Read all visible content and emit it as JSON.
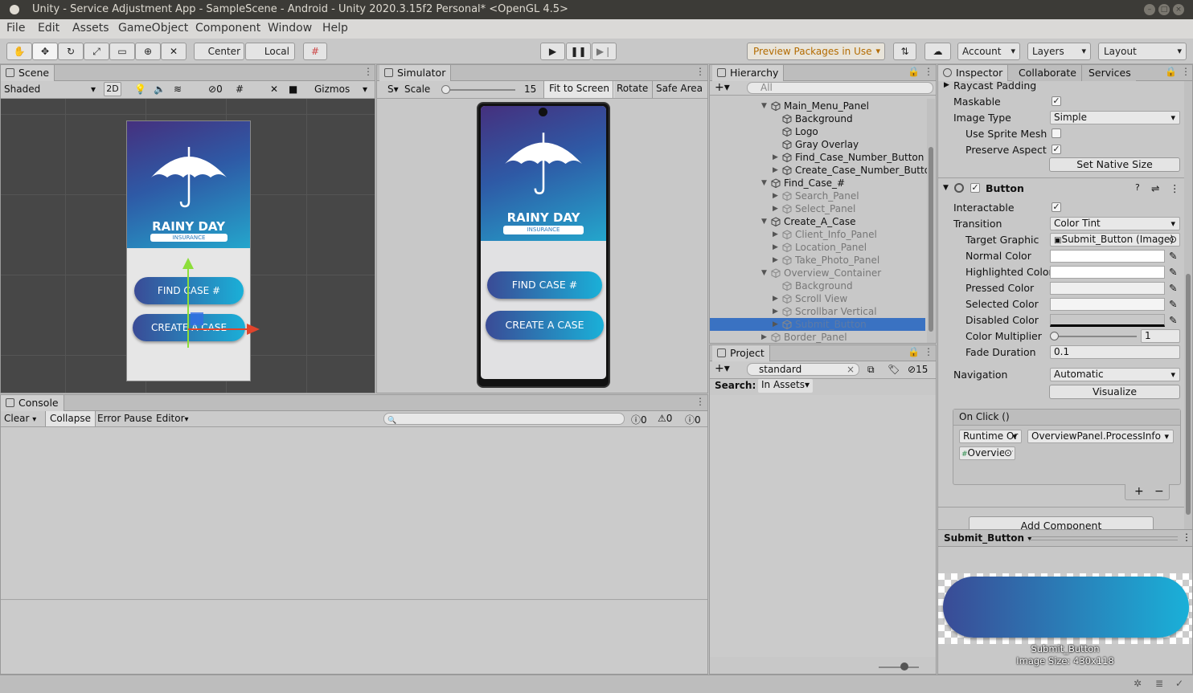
{
  "window": {
    "title": "Unity - Service Adjustment App - SampleScene - Android - Unity 2020.3.15f2 Personal* <OpenGL 4.5>"
  },
  "menu": [
    "File",
    "Edit",
    "Assets",
    "GameObject",
    "Component",
    "Window",
    "Help"
  ],
  "toolbar": {
    "center": "Center",
    "local": "Local",
    "preview_packages": "Preview Packages in Use",
    "account": "Account",
    "layers": "Layers",
    "layout": "Layout"
  },
  "scene": {
    "tab": "Scene",
    "shading": "Shaded",
    "mode_2d": "2D",
    "hidden_count": "0",
    "gizmos": "Gizmos",
    "brand_title": "RAINY DAY",
    "brand_sub": "INSURANCE",
    "btn_find": "FIND CASE #",
    "btn_create": "CREATE A CASE"
  },
  "simulator": {
    "tab": "Simulator",
    "scale_label": "Scale",
    "scale_value": "15",
    "fit": "Fit to Screen",
    "rotate": "Rotate",
    "safe_area": "Safe Area",
    "brand_title": "RAINY DAY",
    "brand_sub": "INSURANCE",
    "btn_find": "FIND CASE #",
    "btn_create": "CREATE A CASE",
    "left_label": "S"
  },
  "hierarchy": {
    "tab": "Hierarchy",
    "search_placeholder": "All",
    "rows": [
      {
        "label": "Main_Menu_Panel",
        "depth": 1,
        "arrow": "open",
        "dim": false
      },
      {
        "label": "Background",
        "depth": 2,
        "arrow": "",
        "dim": false
      },
      {
        "label": "Logo",
        "depth": 2,
        "arrow": "",
        "dim": false
      },
      {
        "label": "Gray Overlay",
        "depth": 2,
        "arrow": "",
        "dim": false
      },
      {
        "label": "Find_Case_Number_Button",
        "depth": 2,
        "arrow": "closed",
        "dim": false
      },
      {
        "label": "Create_Case_Number_Button",
        "depth": 2,
        "arrow": "closed",
        "dim": false
      },
      {
        "label": "Find_Case_#",
        "depth": 1,
        "arrow": "open",
        "dim": false
      },
      {
        "label": "Search_Panel",
        "depth": 2,
        "arrow": "closed",
        "dim": true
      },
      {
        "label": "Select_Panel",
        "depth": 2,
        "arrow": "closed",
        "dim": true
      },
      {
        "label": "Create_A_Case",
        "depth": 1,
        "arrow": "open",
        "dim": false
      },
      {
        "label": "Client_Info_Panel",
        "depth": 2,
        "arrow": "closed",
        "dim": true
      },
      {
        "label": "Location_Panel",
        "depth": 2,
        "arrow": "closed",
        "dim": true
      },
      {
        "label": "Take_Photo_Panel",
        "depth": 2,
        "arrow": "closed",
        "dim": true
      },
      {
        "label": "Overview_Container",
        "depth": 1,
        "arrow": "open",
        "dim": true
      },
      {
        "label": "Background",
        "depth": 2,
        "arrow": "",
        "dim": true
      },
      {
        "label": "Scroll View",
        "depth": 2,
        "arrow": "closed",
        "dim": true
      },
      {
        "label": "Scrollbar Vertical",
        "depth": 2,
        "arrow": "closed",
        "dim": true
      },
      {
        "label": "Submit_Button",
        "depth": 2,
        "arrow": "closed",
        "dim": true,
        "selected": true
      },
      {
        "label": "Border_Panel",
        "depth": 1,
        "arrow": "closed",
        "dim": true
      }
    ]
  },
  "project": {
    "tab": "Project",
    "search_value": "standard",
    "search_label": "Search:",
    "search_scope": "In Assets",
    "hidden_count": "15"
  },
  "console": {
    "tab": "Console",
    "clear": "Clear",
    "collapse": "Collapse",
    "error_pause": "Error Pause",
    "editor": "Editor",
    "log_count": "0",
    "warn_count": "0",
    "error_count": "0"
  },
  "inspector": {
    "tabs": [
      "Inspector",
      "Collaborate",
      "Services"
    ],
    "raycast_padding": "Raycast Padding",
    "maskable": "Maskable",
    "image_type_label": "Image Type",
    "image_type": "Simple",
    "use_sprite_mesh": "Use Sprite Mesh",
    "preserve_aspect": "Preserve Aspect",
    "set_native_size": "Set Native Size",
    "component_title": "Button",
    "interactable": "Interactable",
    "transition_label": "Transition",
    "transition": "Color Tint",
    "target_graphic_label": "Target Graphic",
    "target_graphic": "Submit_Button (Image)",
    "normal_color": "Normal Color",
    "highlighted_color": "Highlighted Color",
    "pressed_color": "Pressed Color",
    "selected_color": "Selected Color",
    "disabled_color": "Disabled Color",
    "color_multiplier": "Color Multiplier",
    "color_multiplier_value": "1",
    "fade_duration": "Fade Duration",
    "fade_duration_value": "0.1",
    "navigation_label": "Navigation",
    "navigation": "Automatic",
    "visualize": "Visualize",
    "onclick_title": "On Click ()",
    "runtime": "Runtime Or",
    "function": "OverviewPanel.ProcessInfo",
    "object": "Overview",
    "add_component": "Add Component",
    "preview_name": "Submit_Button",
    "preview_caption": "Submit_Button",
    "preview_size": "Image Size: 430x118"
  },
  "colors": {
    "accent": "#1ab0d8",
    "brand_dark": "#3a4b96",
    "selection": "#3a72c2"
  }
}
